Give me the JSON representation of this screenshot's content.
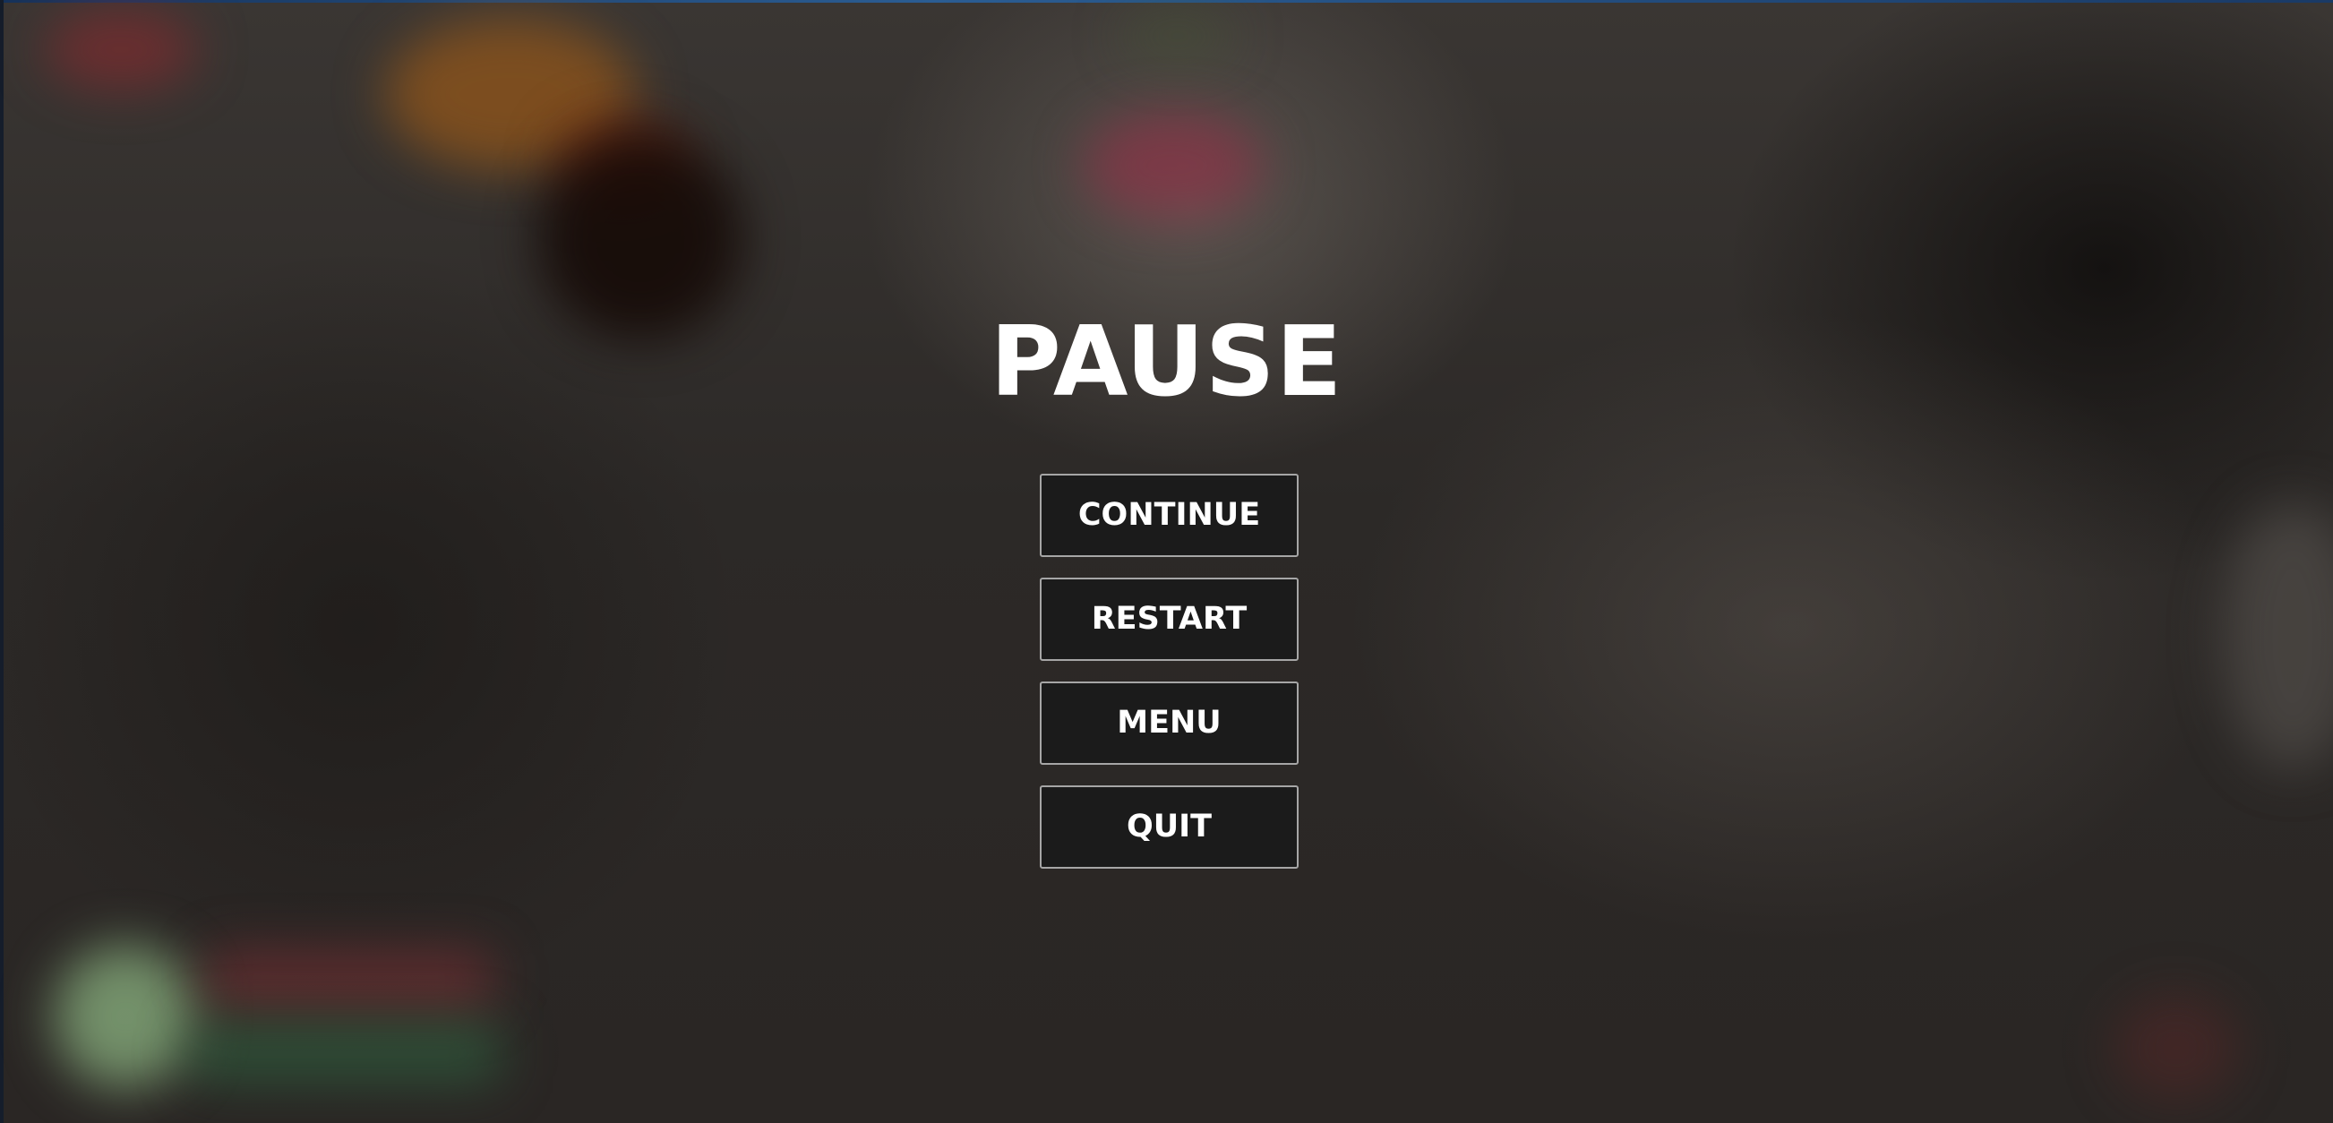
{
  "pause_menu": {
    "title": "PAUSE",
    "buttons": [
      {
        "label": "CONTINUE"
      },
      {
        "label": "RESTART"
      },
      {
        "label": "MENU"
      },
      {
        "label": "QUIT"
      }
    ]
  },
  "colors": {
    "button_background": "#1b1b1b",
    "button_border": "#a6a6a6",
    "text": "#ffffff",
    "window_edge": "#2b5d93"
  }
}
